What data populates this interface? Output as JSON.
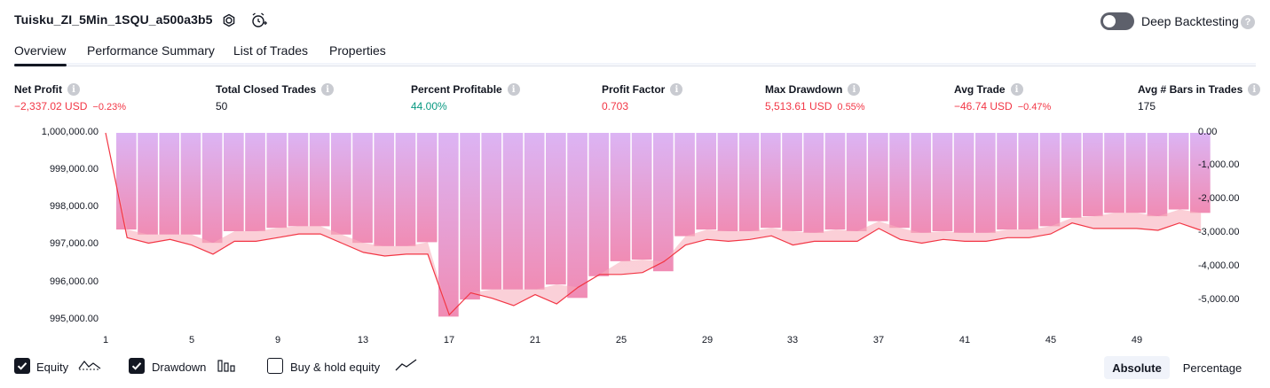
{
  "header": {
    "strategy_name": "Tuisku_ZI_5Min_1SQU_a500a3b5",
    "deep_backtesting_label": "Deep Backtesting",
    "deep_backtesting_enabled": false
  },
  "tabs": [
    {
      "label": "Overview",
      "active": true
    },
    {
      "label": "Performance Summary",
      "active": false
    },
    {
      "label": "List of Trades",
      "active": false
    },
    {
      "label": "Properties",
      "active": false
    }
  ],
  "metrics": [
    {
      "label": "Net Profit",
      "value": "−2,337.02 USD",
      "pct": "−0.23%",
      "color": "#f23645"
    },
    {
      "label": "Total Closed Trades",
      "value": "50",
      "pct": "",
      "color": "#131722"
    },
    {
      "label": "Percent Profitable",
      "value": "44.00%",
      "pct": "",
      "color": "#089981"
    },
    {
      "label": "Profit Factor",
      "value": "0.703",
      "pct": "",
      "color": "#f23645"
    },
    {
      "label": "Max Drawdown",
      "value": "5,513.61 USD",
      "pct": "0.55%",
      "color": "#f23645"
    },
    {
      "label": "Avg Trade",
      "value": "−46.74 USD",
      "pct": "−0.47%",
      "color": "#f23645"
    },
    {
      "label": "Avg # Bars in Trades",
      "value": "175",
      "pct": "",
      "color": "#131722"
    }
  ],
  "chart_data": {
    "type": "bar",
    "left_axis_ticks": [
      "1,000,000.00",
      "999,000.00",
      "998,000.00",
      "997,000.00",
      "996,000.00",
      "995,000.00"
    ],
    "right_axis_ticks": [
      "0.00",
      "-1,000.00",
      "-2,000.00",
      "-3,000.00",
      "-4,000.00",
      "-5,000.00"
    ],
    "x_ticks": [
      "1",
      "5",
      "9",
      "13",
      "17",
      "21",
      "25",
      "29",
      "33",
      "37",
      "41",
      "45",
      "49"
    ],
    "ylim_equity": [
      994650,
      1000000
    ],
    "ylim_drawdown": [
      -5900,
      0
    ],
    "trades": [
      1,
      2,
      3,
      4,
      5,
      6,
      7,
      8,
      9,
      10,
      11,
      12,
      13,
      14,
      15,
      16,
      17,
      18,
      19,
      20,
      21,
      22,
      23,
      24,
      25,
      26,
      27,
      28,
      29,
      30,
      31,
      32,
      33,
      34,
      35,
      36,
      37,
      38,
      39,
      40,
      41,
      42,
      43,
      44,
      45,
      46,
      47,
      48,
      49,
      50,
      51,
      52
    ],
    "series": [
      {
        "name": "Equity",
        "values": [
          1000000,
          997150,
          997000,
          997100,
          996950,
          996700,
          997050,
          997050,
          997150,
          997250,
          997250,
          997000,
          996750,
          996650,
          996700,
          996700,
          995050,
          995650,
          995500,
          995300,
          995600,
          995350,
          995800,
          996150,
          996150,
          996200,
          996500,
          996950,
          997100,
          997050,
          997100,
          997200,
          996950,
          997050,
          997050,
          997050,
          997400,
          997100,
          997000,
          997100,
          997050,
          997050,
          997150,
          997150,
          997250,
          997550,
          997400,
          997400,
          997400,
          997350,
          997550,
          997350
        ]
      },
      {
        "name": "Drawdown",
        "values": [
          0,
          -2900,
          -3050,
          -3050,
          -3050,
          -3300,
          -2950,
          -2950,
          -2850,
          -2800,
          -2800,
          -3050,
          -3300,
          -3400,
          -3400,
          -3280,
          -5513,
          -5000,
          -4700,
          -4700,
          -4700,
          -4550,
          -4950,
          -4300,
          -3850,
          -3800,
          -4150,
          -3100,
          -2900,
          -2950,
          -2950,
          -2850,
          -2950,
          -3000,
          -2900,
          -2950,
          -2650,
          -2850,
          -3000,
          -2950,
          -3000,
          -3000,
          -2900,
          -2900,
          -2800,
          -2550,
          -2500,
          -2400,
          -2400,
          -2500,
          -2300,
          -2400
        ]
      }
    ],
    "equity_color": "#f23645",
    "drawdown_color": "#c89af5"
  },
  "legend": {
    "equity_label": "Equity",
    "equity_checked": true,
    "drawdown_label": "Drawdown",
    "drawdown_checked": true,
    "buyhold_label": "Buy & hold equity",
    "buyhold_checked": false
  },
  "scale_buttons": {
    "absolute": "Absolute",
    "percentage": "Percentage",
    "selected": "absolute"
  }
}
